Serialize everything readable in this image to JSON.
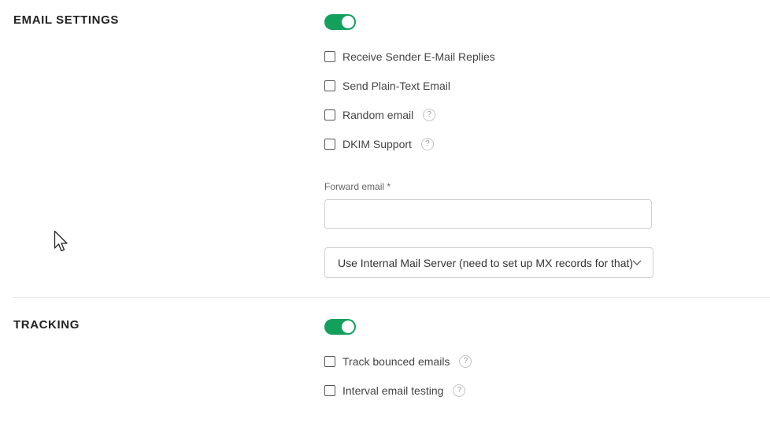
{
  "email_settings": {
    "title": "EMAIL SETTINGS",
    "enabled": true,
    "options": [
      {
        "label": "Receive Sender E-Mail Replies",
        "checked": false,
        "help": false
      },
      {
        "label": "Send Plain-Text Email",
        "checked": false,
        "help": false
      },
      {
        "label": "Random email",
        "checked": false,
        "help": true
      },
      {
        "label": "DKIM Support",
        "checked": false,
        "help": true
      }
    ],
    "forward_email": {
      "label": "Forward email *",
      "value": "",
      "placeholder": ""
    },
    "mail_server": {
      "selected": "Use Internal Mail Server (need to set up MX records for that)"
    }
  },
  "tracking": {
    "title": "TRACKING",
    "enabled": true,
    "options": [
      {
        "label": "Track bounced emails",
        "checked": false,
        "help": true
      },
      {
        "label": "Interval email testing",
        "checked": false,
        "help": true
      }
    ]
  },
  "help_glyph": "?",
  "colors": {
    "toggle_on": "#12a05c",
    "divider": "#e6e6e6"
  },
  "icons": {
    "help": "question-circle-icon",
    "chevron": "chevron-down-icon",
    "cursor": "mouse-pointer-icon"
  }
}
